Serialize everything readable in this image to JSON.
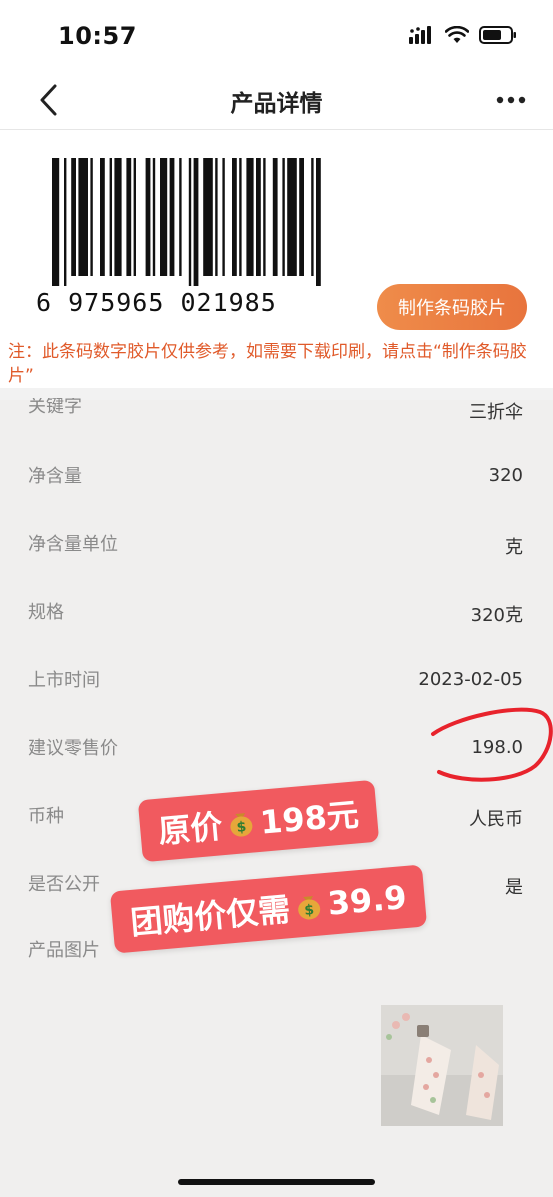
{
  "status_bar": {
    "time": "10:57"
  },
  "nav": {
    "title": "产品详情"
  },
  "barcode": {
    "digits": "6  975965  021985",
    "make_button": "制作条码胶片",
    "note": "注：此条码数字胶片仅供参考，如需要下载印刷，请点击“制作条码胶片”"
  },
  "attributes": [
    {
      "label": "关键字",
      "value": "三折伞"
    },
    {
      "label": "净含量",
      "value": "320"
    },
    {
      "label": "净含量单位",
      "value": "克"
    },
    {
      "label": "规格",
      "value": "320克"
    },
    {
      "label": "上市时间",
      "value": "2023-02-05"
    },
    {
      "label": "建议零售价",
      "value": "198.0"
    },
    {
      "label": "币种",
      "value": "人民币"
    },
    {
      "label": "是否公开",
      "value": "是"
    },
    {
      "label": "产品图片",
      "value": ""
    }
  ],
  "stickers": {
    "original_prefix": "原价",
    "original_suffix": "198元",
    "group_prefix": "团购价仅需",
    "group_suffix": "39.9"
  },
  "icons": {
    "back": "chevron-left-icon",
    "more": "more-dots-icon",
    "money": "money-bag-icon",
    "signal": "signal-icon",
    "wifi": "wifi-icon",
    "battery": "battery-icon"
  },
  "colors": {
    "accent_orange": "#e8743d",
    "note_text": "#e05a2a",
    "sticker_red": "#f15a5f",
    "circle_red": "#e8232c"
  }
}
